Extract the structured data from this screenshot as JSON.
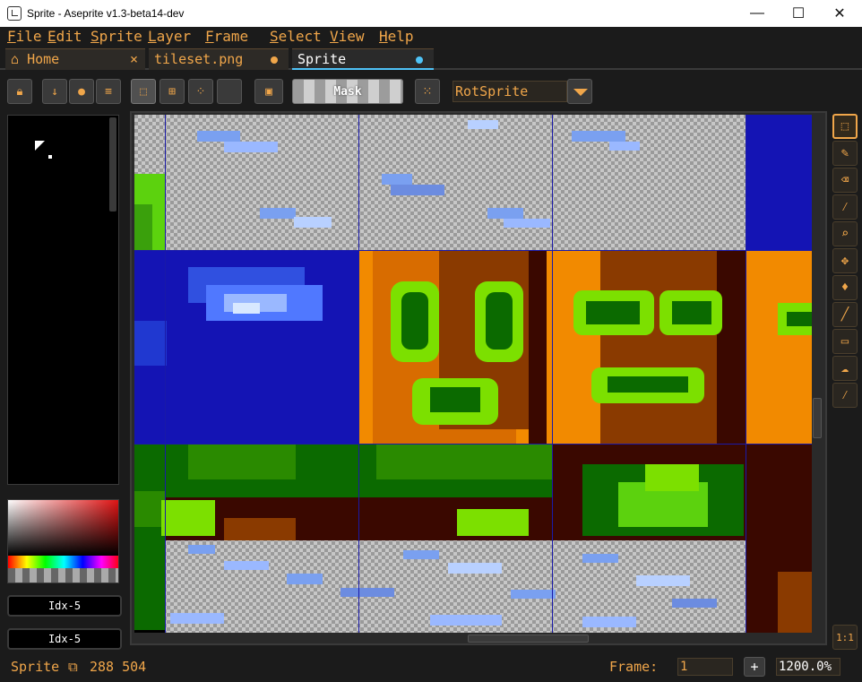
{
  "window": {
    "title": "Sprite - Aseprite v1.3-beta14-dev",
    "minimize": "—",
    "maximize": "☐",
    "close": "✕"
  },
  "menu": [
    "File",
    "Edit",
    "Sprite",
    "Layer",
    "Frame",
    "Select",
    "View",
    "Help"
  ],
  "tabs": [
    {
      "label": "Home",
      "icon": "home-icon",
      "marker": "×"
    },
    {
      "label": "tileset.png",
      "marker": "modified-dot",
      "marker_color": "#f0a64a"
    },
    {
      "label": "Sprite",
      "marker": "modified-dot",
      "marker_color": "#4fc3f7",
      "active": true
    }
  ],
  "toolbar": {
    "mask_label": "Mask",
    "algorithm": "RotSprite"
  },
  "left": {
    "fg_index": "Idx-5",
    "bg_index": "Idx-5"
  },
  "status": {
    "doc_label": "Sprite",
    "coords": "288 504",
    "frame_label": "Frame:",
    "frame_value": "1",
    "plus": "+",
    "zoom": "1200.0%"
  },
  "tools": [
    "rectangular-marquee-icon",
    "pencil-icon",
    "eraser-icon",
    "eyedropper-icon",
    "zoom-icon",
    "move-icon",
    "paint-bucket-icon",
    "line-icon",
    "rectangle-icon",
    "contour-icon",
    "blur-icon"
  ],
  "tools_bottom": "1:1",
  "colors": {
    "accent": "#f0a64a",
    "active_tab_marker": "#4fc3f7",
    "grid": "#1a1aa8"
  }
}
